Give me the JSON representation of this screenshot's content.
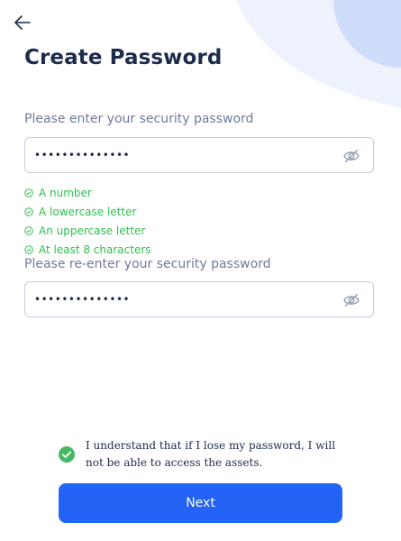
{
  "header": {
    "title": "Create Password"
  },
  "password": {
    "label": "Please enter your security password",
    "value": "••••••••••••••"
  },
  "requirements": [
    "A number",
    "A lowercase letter",
    "An uppercase letter",
    "At least 8 characters"
  ],
  "confirm": {
    "label": "Please re-enter your security password",
    "value": "••••••••••••••"
  },
  "agreement": {
    "checked": true,
    "text": "I understand that if I lose my password, I will not be able to access the assets."
  },
  "next_button": {
    "label": "Next"
  },
  "colors": {
    "accent": "#2563f6",
    "success": "#2ec04f",
    "checkbox": "#47b964",
    "text": "#1f2b4d",
    "label": "#6f7a9e",
    "border": "#c6cbe0",
    "decor_light": "#eef2fd",
    "decor": "#cfdcfa"
  },
  "icons": {
    "back": "arrow-left-icon",
    "visibility": "eye-off-icon",
    "requirement": "check-circle-icon",
    "agree": "checkbox-checked-icon"
  }
}
